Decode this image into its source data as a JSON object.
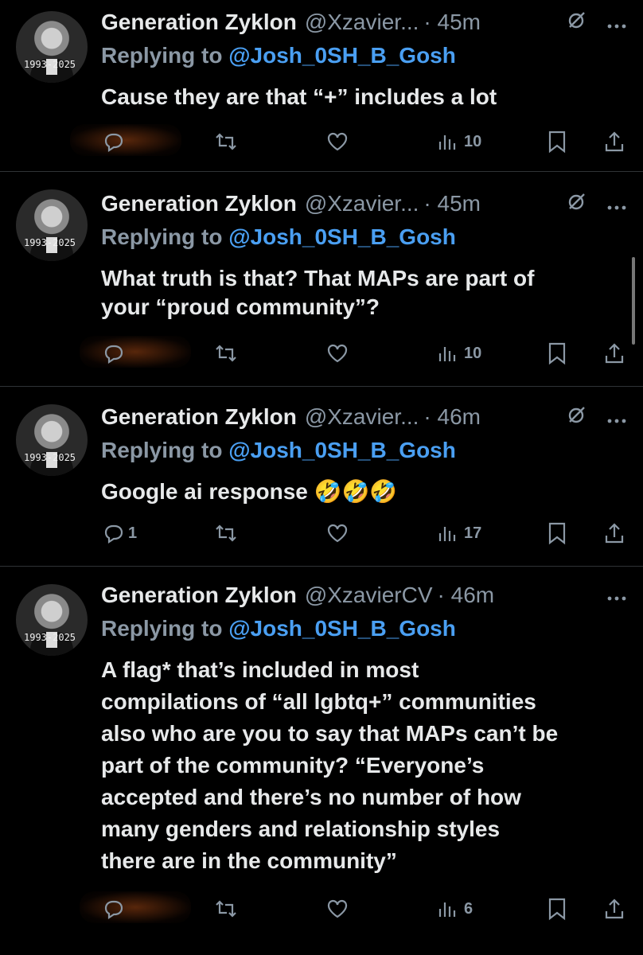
{
  "tweets": [
    {
      "name": "Generation Zyklon",
      "handle": "@Xzavier...",
      "time": "· 45m",
      "reply_prefix": "Replying to",
      "reply_to": "@Josh_0SH_B_Gosh",
      "body": [
        "Cause they are that “+” includes a lot"
      ],
      "avatar_dates": "1993-2025",
      "replies": "",
      "views": "10"
    },
    {
      "name": "Generation Zyklon",
      "handle": "@Xzavier...",
      "time": "· 45m",
      "reply_prefix": "Replying to",
      "reply_to": "@Josh_0SH_B_Gosh",
      "body": [
        "What truth is that? That MAPs are part of",
        "your “proud community”?"
      ],
      "avatar_dates": "1993-2025",
      "replies": "",
      "views": "10"
    },
    {
      "name": "Generation Zyklon",
      "handle": "@Xzavier...",
      "time": "· 46m",
      "reply_prefix": "Replying to",
      "reply_to": "@Josh_0SH_B_Gosh",
      "body": [
        "Google ai response 🤣🤣🤣"
      ],
      "avatar_dates": "1993-2025",
      "replies": "1",
      "views": "17"
    },
    {
      "name": "Generation Zyklon",
      "handle": "@XzavierCV",
      "time": "· 46m",
      "reply_prefix": "Replying to",
      "reply_to": "@Josh_0SH_B_Gosh",
      "body": [
        "A flag* that’s included in most",
        "compilations of “all lgbtq+” communities",
        "also who are you to say that MAPs can’t be",
        "part of the community? “Everyone’s",
        "accepted and there’s no number of how",
        "many genders and relationship styles",
        "there are in the community”"
      ],
      "avatar_dates": "1993-2025",
      "replies": "",
      "views": "6"
    }
  ],
  "icons": {
    "grok": "grok-icon",
    "more": "more-icon",
    "reply": "reply-icon",
    "retweet": "retweet-icon",
    "like": "like-icon",
    "views": "views-icon",
    "bookmark": "bookmark-icon",
    "share": "share-icon"
  },
  "colors": {
    "background": "#000000",
    "text": "#e7e9ea",
    "muted": "#8b98a5",
    "mention": "#4a9ff2",
    "divider": "#2f3336"
  }
}
